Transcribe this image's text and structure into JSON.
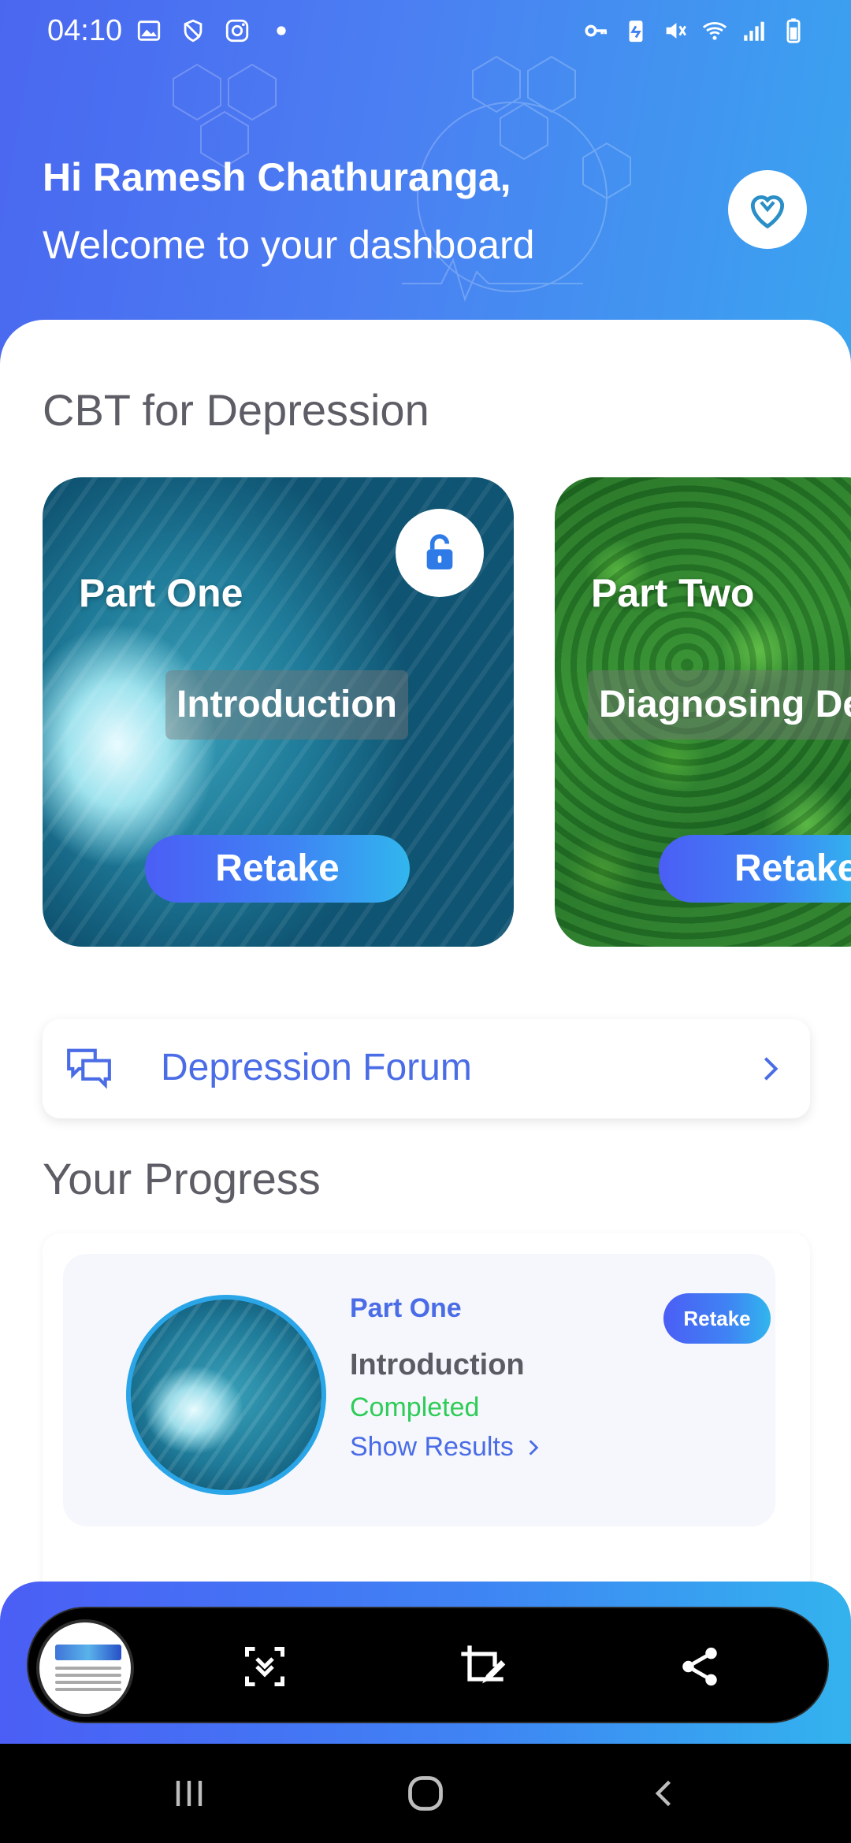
{
  "status_bar": {
    "time": "04:10",
    "left_icons": [
      "gallery-icon",
      "shield-icon",
      "instagram-icon",
      "dot-icon"
    ],
    "right_icons": [
      "key-icon",
      "battery-saver-icon",
      "mute-icon",
      "wifi-icon",
      "signal-icon",
      "battery-icon"
    ]
  },
  "header": {
    "greeting": "Hi  Ramesh Chathuranga,",
    "subtitle": "Welcome to your dashboard",
    "action_icon": "heart-stethoscope-icon"
  },
  "program": {
    "title": "CBT for Depression",
    "cards": [
      {
        "part": "Part One",
        "topic": "Introduction",
        "button": "Retake",
        "locked": false
      },
      {
        "part": "Part Two",
        "topic": "Diagnosing Dep",
        "button": "Retake"
      }
    ]
  },
  "forum": {
    "label": "Depression Forum"
  },
  "progress": {
    "title": "Your Progress",
    "item": {
      "part": "Part One",
      "topic": "Introduction",
      "status": "Completed",
      "link": "Show Results",
      "button": "Retake"
    }
  },
  "colors": {
    "brand_blue": "#4a6ce6",
    "gradient_start": "#4b5ef5",
    "gradient_end": "#31b6ee",
    "completed_green": "#2ecc58"
  },
  "capture_toolbar": {
    "tools": [
      "scroll-capture-icon",
      "crop-edit-icon",
      "share-icon"
    ]
  },
  "system_nav": {
    "buttons": [
      "recents",
      "home",
      "back"
    ]
  }
}
